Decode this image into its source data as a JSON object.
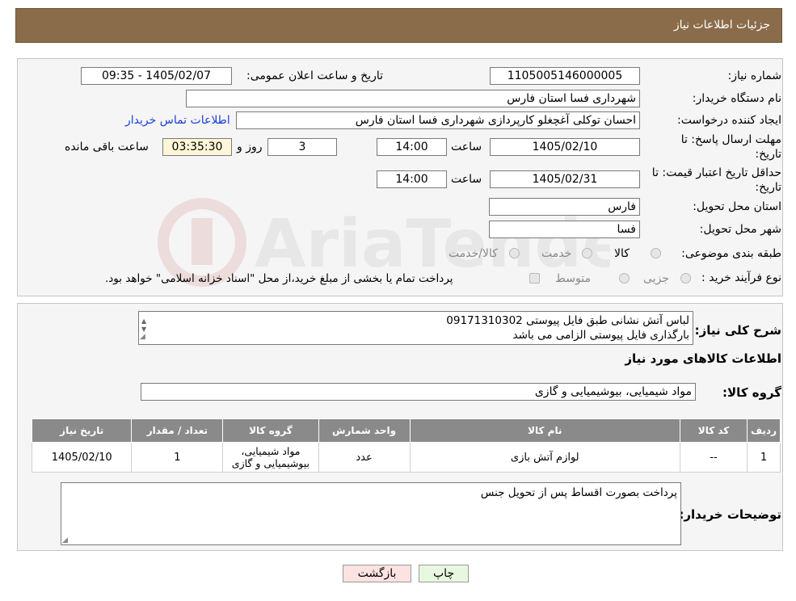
{
  "header": {
    "title": "جزئیات اطلاعات نیاز"
  },
  "form": {
    "need_number_label": "شماره نیاز:",
    "need_number": "1105005146000005",
    "announce_label": "تاریخ و ساعت اعلان عمومی:",
    "announce_value": "1405/02/07 - 09:35",
    "buyer_org_label": "نام دستگاه خریدار:",
    "buyer_org": "شهرداری فسا استان فارس",
    "creator_label": "ایجاد کننده درخواست:",
    "creator": "احسان توکلی آغچغلو کارپردازی شهرداری فسا استان فارس",
    "contact_link": "اطلاعات تماس خریدار",
    "deadline_label_1": "مهلت ارسال پاسخ: تا",
    "deadline_label_2": "تاریخ:",
    "deadline_date": "1405/02/10",
    "time_label": "ساعت",
    "deadline_time": "14:00",
    "days_value": "3",
    "days_label": "روز و",
    "remaining_time": "03:35:30",
    "remaining_label": "ساعت باقی مانده",
    "validity_label_1": "حداقل تاریخ اعتبار قیمت: تا",
    "validity_label_2": "تاریخ:",
    "validity_date": "1405/02/31",
    "validity_time_label": "ساعت",
    "validity_time": "14:00",
    "province_label": "استان محل تحویل:",
    "province": "فارس",
    "city_label": "شهر محل تحویل:",
    "city": "فسا",
    "category_label": "طبقه بندی موضوعی:",
    "category_options": [
      "کالا",
      "خدمت",
      "کالا/خدمت"
    ],
    "process_label": "نوع فرآیند خرید :",
    "process_options": [
      "جزیی",
      "متوسط"
    ],
    "process_note": "پرداخت تمام یا بخشی از مبلغ خرید،از محل \"اسناد خزانه اسلامی\" خواهد بود."
  },
  "description": {
    "label": "شرح کلی نیاز:",
    "line1": "لباس آتش نشانی طبق فایل پیوستی 09171310302",
    "line2": "بارگذاری فایل پیوستی الزامی می باشد"
  },
  "goods": {
    "section_title": "اطلاعات کالاهای مورد نیاز",
    "group_label": "گروه کالا:",
    "group_value": "مواد شیمیایی، بیوشیمیایی و  گازی",
    "columns": [
      "ردیف",
      "کد کالا",
      "نام کالا",
      "واحد شمارش",
      "گروه کالا",
      "تعداد / مقدار",
      "تاریخ نیاز"
    ],
    "rows": [
      {
        "row": "1",
        "code": "--",
        "name": "لوازم آتش بازی",
        "unit": "عدد",
        "group": "مواد شیمیایی، بیوشیمیایی و گازی",
        "qty": "1",
        "date": "1405/02/10"
      }
    ]
  },
  "buyer_notes": {
    "label": "توضیحات خریدار:",
    "text": "پرداخت بصورت اقساط پس از تحویل جنس"
  },
  "buttons": {
    "print": "چاپ",
    "back": "بازگشت"
  },
  "colors": {
    "header_bg": "#8a6c4a",
    "link": "#1a3fd6",
    "back_button_bg": "#fde2e2",
    "print_button_bg": "#e8f8e0"
  }
}
